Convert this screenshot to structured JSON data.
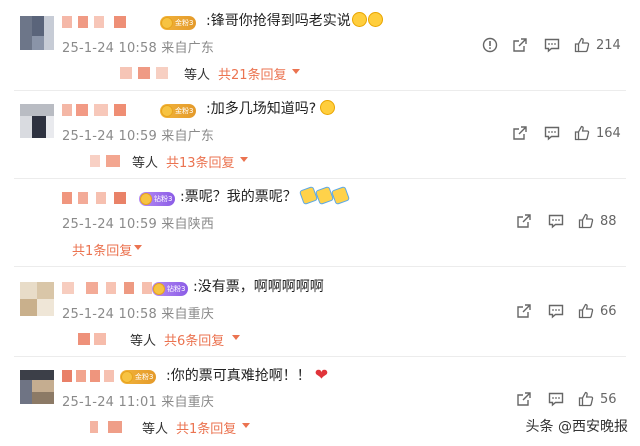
{
  "comments": [
    {
      "badge": "金粉3",
      "text": ":锋哥你抢得到吗老实说",
      "time": "25-1-24 10:58 来自广东",
      "likes": "214",
      "replies": {
        "deng": "等人",
        "count": "共21条回复"
      }
    },
    {
      "badge": "金粉3",
      "text": ":加多几场知道吗?",
      "time": "25-1-24 10:59 来自广东",
      "likes": "164",
      "replies": {
        "deng": "等人",
        "count": "共13条回复"
      }
    },
    {
      "badge": "钻粉3",
      "text": ":票呢？我的票呢？",
      "time": "25-1-24 10:59 来自陕西",
      "likes": "88",
      "replies": {
        "deng": "",
        "count": "共1条回复"
      }
    },
    {
      "badge": "钻粉3",
      "text": ":没有票，啊啊啊啊啊",
      "time": "25-1-24 10:58 来自重庆",
      "likes": "66",
      "replies": {
        "deng": "等人",
        "count": "共6条回复"
      }
    },
    {
      "badge": "金粉3",
      "text": ":你的票可真难抢啊！！",
      "time": "25-1-24 11:01 来自重庆",
      "likes": "56",
      "replies": {
        "deng": "等人",
        "count": "共1条回复"
      }
    }
  ],
  "watermark": "头条 @西安晚报",
  "icons": {
    "report": "report-icon",
    "share": "share-icon",
    "comment": "comment-icon",
    "like": "thumbs-up-icon"
  },
  "colors": {
    "accent": "#eb7350",
    "meta": "#8a8a8a"
  }
}
